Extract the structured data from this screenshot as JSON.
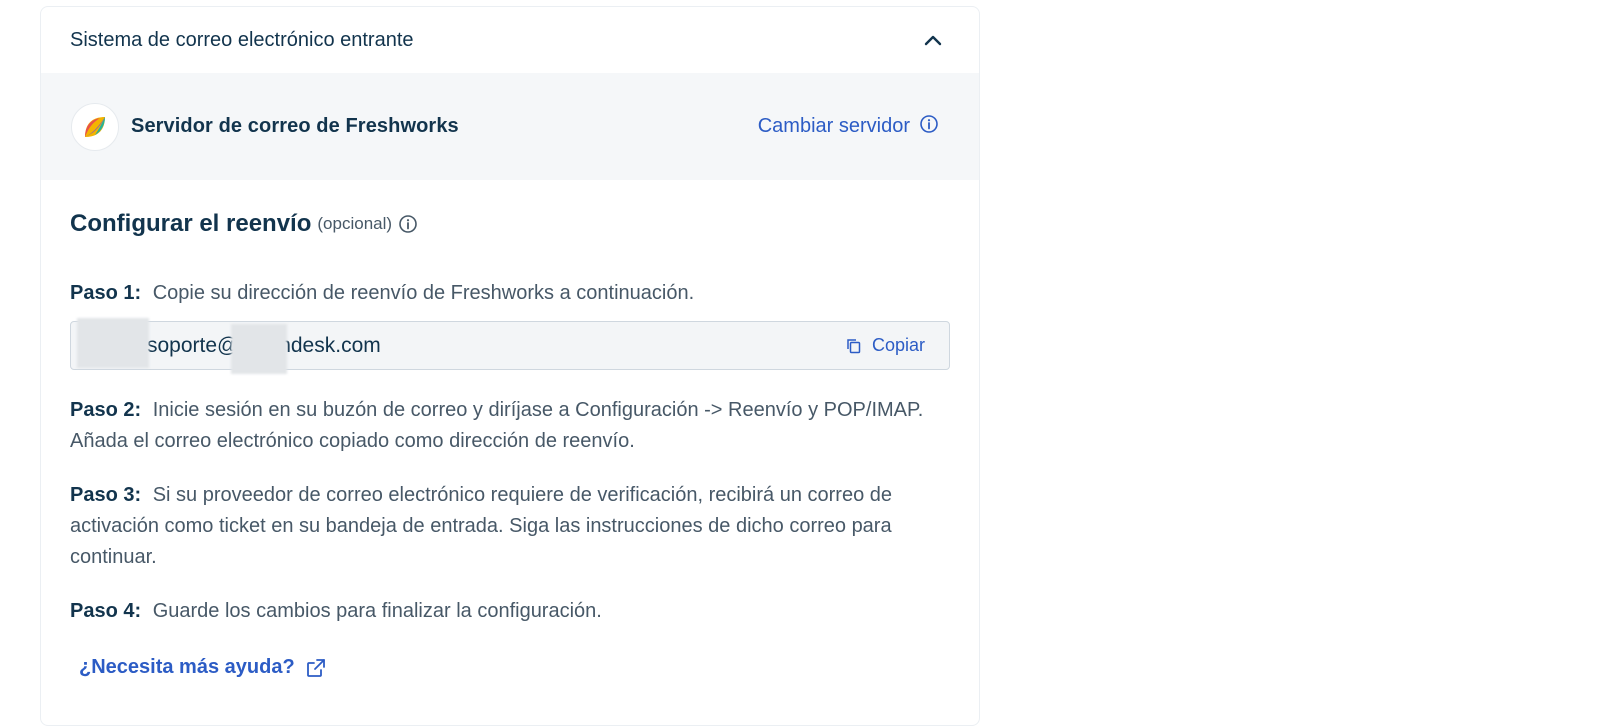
{
  "card": {
    "title": "Sistema de correo electrónico entrante"
  },
  "server": {
    "name": "Servidor de correo de Freshworks",
    "change_label": "Cambiar servidor"
  },
  "forwarding": {
    "title": "Configurar el reenvío",
    "optional": "(opcional)",
    "steps": [
      {
        "label": "Paso 1:",
        "text": "Copie su dirección de reenvío de Freshworks a continuación."
      },
      {
        "label": "Paso 2:",
        "text": "Inicie sesión en su buzón de correo y diríjase a Configuración -> Reenvío y POP/IMAP. Añada el correo electrónico copiado como dirección de reenvío."
      },
      {
        "label": "Paso 3:",
        "text": "Si su proveedor de correo electrónico requiere de verificación, recibirá un correo de activación como ticket en su bandeja de entrada. Siga las instrucciones de dicho correo para continuar."
      },
      {
        "label": "Paso 4:",
        "text": "Guarde los cambios para finalizar la configuración."
      }
    ],
    "email_value": "soporte@ freshdesk.com",
    "copy_label": "Copiar",
    "help_link": "¿Necesita más ayuda?"
  },
  "colors": {
    "link": "#2c5cc5",
    "heading": "#12344d",
    "body_text": "#475867",
    "panel_bg": "#f5f7f9"
  }
}
